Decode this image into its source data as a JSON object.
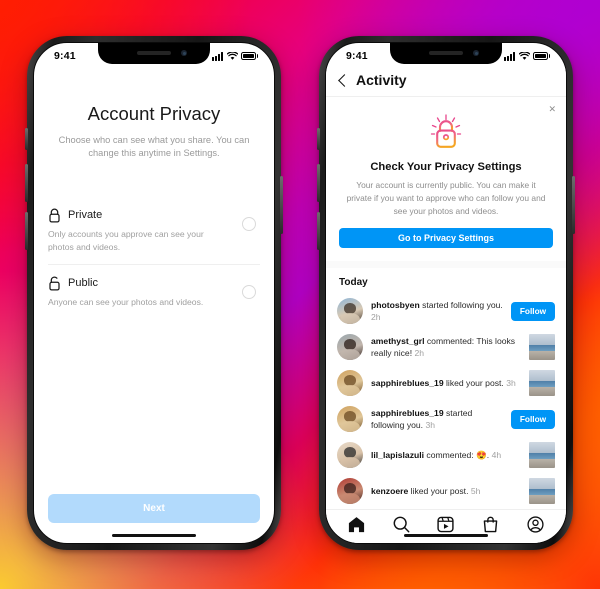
{
  "background": {
    "gradient_colors": [
      "#ff1a0d",
      "#e6007e",
      "#b300c9",
      "#ff7a00",
      "#ffd021"
    ]
  },
  "colors": {
    "accent_blue": "#0095f6",
    "disabled_blue": "#b2dafc",
    "muted_gray": "#8e8e8e"
  },
  "left_phone": {
    "status_bar": {
      "time": "9:41",
      "signal_icon": "signal-bars-icon",
      "wifi_icon": "wifi-icon",
      "battery_icon": "battery-icon"
    },
    "title": "Account Privacy",
    "subtitle": "Choose who can see what you share. You can change this anytime in Settings.",
    "options": [
      {
        "icon": "lock-closed-icon",
        "name": "Private",
        "description": "Only accounts you approve can see your photos and videos.",
        "selected": false
      },
      {
        "icon": "lock-open-icon",
        "name": "Public",
        "description": "Anyone can see your photos and videos.",
        "selected": false
      }
    ],
    "next_button": "Next"
  },
  "right_phone": {
    "status_bar": {
      "time": "9:41",
      "signal_icon": "signal-bars-icon",
      "wifi_icon": "wifi-icon",
      "battery_icon": "battery-icon"
    },
    "header": {
      "back_icon": "back-chevron-icon",
      "title": "Activity"
    },
    "privacy_card": {
      "close_icon": "close-x-icon",
      "lock_icon": "lock-sparkle-icon",
      "title": "Check Your Privacy Settings",
      "body": "Your account is currently public. You can make it private if you want to approve who can follow you and see your photos and videos.",
      "button": "Go to Privacy Settings"
    },
    "section_label": "Today",
    "activity": [
      {
        "avatar": "avatar-photosbyen",
        "username": "photosbyen",
        "action": " started following you.",
        "time": "2h",
        "trailing": "follow-button",
        "follow_label": "Follow"
      },
      {
        "avatar": "avatar-amethyst_grl",
        "username": "amethyst_grl",
        "action": " commented: This looks really nice!",
        "time": "2h",
        "trailing": "post-thumbnail"
      },
      {
        "avatar": "avatar-sapphireblues_19",
        "username": "sapphireblues_19",
        "action": " liked your post.",
        "time": "3h",
        "trailing": "post-thumbnail"
      },
      {
        "avatar": "avatar-sapphireblues_19",
        "username": "sapphireblues_19",
        "action": " started following you.",
        "time": "3h",
        "trailing": "follow-button",
        "follow_label": "Follow"
      },
      {
        "avatar": "avatar-lil_lapislazuli",
        "username": "lil_lapislazuli",
        "action": " commented: 😍.",
        "time": "4h",
        "trailing": "post-thumbnail"
      },
      {
        "avatar": "avatar-kenzoere",
        "username": "kenzoere",
        "action": " liked your post.",
        "time": "5h",
        "trailing": "post-thumbnail"
      }
    ],
    "tabbar": [
      {
        "icon": "home-icon",
        "active": true
      },
      {
        "icon": "search-icon",
        "active": false
      },
      {
        "icon": "reels-icon",
        "active": false
      },
      {
        "icon": "shop-bag-icon",
        "active": false
      },
      {
        "icon": "profile-icon",
        "active": false
      }
    ]
  }
}
